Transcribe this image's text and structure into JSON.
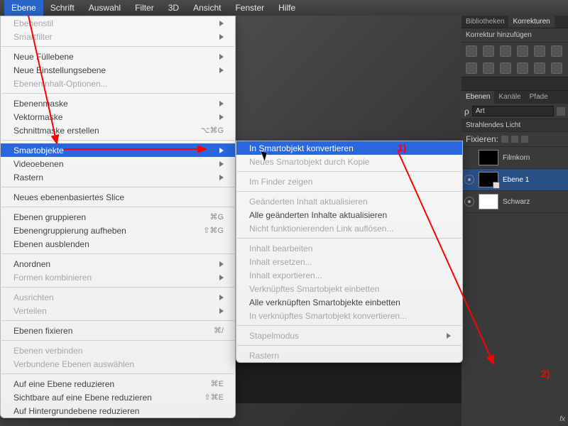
{
  "menubar": {
    "items": [
      "Ebene",
      "Schrift",
      "Auswahl",
      "Filter",
      "3D",
      "Ansicht",
      "Fenster",
      "Hilfe"
    ],
    "open_index": 0
  },
  "main_menu": [
    {
      "label": "Ebenenstil",
      "disabled": true,
      "sub": true
    },
    {
      "label": "Smartfilter",
      "disabled": true,
      "sub": true
    },
    {
      "sep": true
    },
    {
      "label": "Neue Füllebene",
      "sub": true
    },
    {
      "label": "Neue Einstellungsebene",
      "sub": true
    },
    {
      "label": "Ebeneninhalt-Optionen...",
      "disabled": true
    },
    {
      "sep": true
    },
    {
      "label": "Ebenenmaske",
      "sub": true
    },
    {
      "label": "Vektormaske",
      "sub": true
    },
    {
      "label": "Schnittmaske erstellen",
      "kb": "⌥⌘G"
    },
    {
      "sep": true
    },
    {
      "label": "Smartobjekte",
      "sub": true,
      "highlight": true
    },
    {
      "label": "Videoebenen",
      "sub": true
    },
    {
      "label": "Rastern",
      "sub": true
    },
    {
      "sep": true
    },
    {
      "label": "Neues ebenenbasiertes Slice"
    },
    {
      "sep": true
    },
    {
      "label": "Ebenen gruppieren",
      "kb": "⌘G"
    },
    {
      "label": "Ebenengruppierung aufheben",
      "kb": "⇧⌘G"
    },
    {
      "label": "Ebenen ausblenden"
    },
    {
      "sep": true
    },
    {
      "label": "Anordnen",
      "sub": true
    },
    {
      "label": "Formen kombinieren",
      "disabled": true,
      "sub": true
    },
    {
      "sep": true
    },
    {
      "label": "Ausrichten",
      "disabled": true,
      "sub": true
    },
    {
      "label": "Verteilen",
      "disabled": true,
      "sub": true
    },
    {
      "sep": true
    },
    {
      "label": "Ebenen fixieren",
      "kb": "⌘/"
    },
    {
      "sep": true
    },
    {
      "label": "Ebenen verbinden",
      "disabled": true
    },
    {
      "label": "Verbundene Ebenen auswählen",
      "disabled": true
    },
    {
      "sep": true
    },
    {
      "label": "Auf eine Ebene reduzieren",
      "kb": "⌘E"
    },
    {
      "label": "Sichtbare auf eine Ebene reduzieren",
      "kb": "⇧⌘E"
    },
    {
      "label": "Auf Hintergrundebene reduzieren"
    }
  ],
  "sub_menu": [
    {
      "label": "In Smartobjekt konvertieren",
      "highlight": true
    },
    {
      "label": "Neues Smartobjekt durch Kopie",
      "disabled": true
    },
    {
      "sep": true
    },
    {
      "label": "Im Finder zeigen",
      "disabled": true
    },
    {
      "sep": true
    },
    {
      "label": "Geänderten Inhalt aktualisieren",
      "disabled": true
    },
    {
      "label": "Alle geänderten Inhalte aktualisieren"
    },
    {
      "label": "Nicht funktionierenden Link auflösen...",
      "disabled": true
    },
    {
      "sep": true
    },
    {
      "label": "Inhalt bearbeiten",
      "disabled": true
    },
    {
      "label": "Inhalt ersetzen...",
      "disabled": true
    },
    {
      "label": "Inhalt exportieren...",
      "disabled": true
    },
    {
      "label": "Verknüpftes Smartobjekt einbetten",
      "disabled": true
    },
    {
      "label": "Alle verknüpften Smartobjekte einbetten"
    },
    {
      "label": "In verknüpftes Smartobjekt konvertieren...",
      "disabled": true
    },
    {
      "sep": true
    },
    {
      "label": "Stapelmodus",
      "disabled": true,
      "sub": true
    },
    {
      "sep": true
    },
    {
      "label": "Rastern",
      "disabled": true
    }
  ],
  "dock": {
    "libs_tab": "Bibliotheken",
    "adjust_tab": "Korrekturen",
    "adjust_sub": "Korrektur hinzufügen",
    "layers_tab": "Ebenen",
    "channels_tab": "Kanäle",
    "paths_tab": "Pfade",
    "kind_label": "ρ",
    "kind_value": "Art",
    "group": "Strahlendes Licht",
    "lock_label": "Fixieren:",
    "layer1_name": "Ebene 1",
    "layer2_name": "Schwarz",
    "fx": "fx"
  },
  "annotations": {
    "a1": "1)",
    "a2": "2)"
  }
}
